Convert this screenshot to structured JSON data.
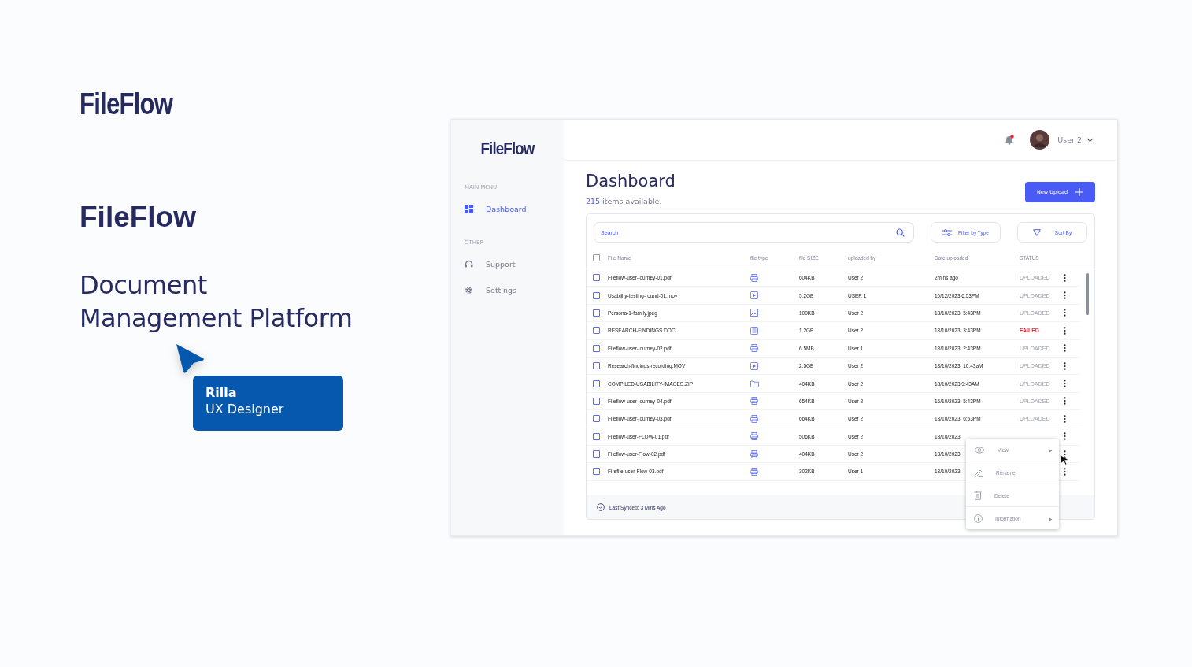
{
  "slide": {
    "logo": "FileFlow",
    "product": "FileFlow",
    "tagline": [
      "Document",
      "Management Platform"
    ],
    "badge": {
      "name": "Rilla",
      "role": "UX Designer"
    }
  },
  "app": {
    "logo": "FileFlow",
    "sidebar": [
      {
        "heading": "MAIN MENU",
        "items": [
          {
            "label": "Dashboard",
            "kind": "grid",
            "selected": true
          }
        ]
      },
      {
        "heading": "OTHER",
        "items": [
          {
            "label": "Support",
            "kind": "headset",
            "selected": false
          },
          {
            "label": "Settings",
            "kind": "gear",
            "selected": false
          }
        ]
      }
    ],
    "user": {
      "name": "User 2",
      "notification": true
    },
    "title": "Dashboard",
    "count": "215",
    "count_suffix": "items available.",
    "new_button": "New Upload",
    "search": {
      "placeholder": "Search"
    },
    "filter_button": "Filter by Type",
    "sort_button": "Sort By",
    "table": {
      "header_checked": false,
      "columns": [
        "File Name",
        "file type",
        "file SIZE",
        "uploaded by",
        "Date uploaded",
        "STATUS"
      ],
      "rows": [
        {
          "checked": false,
          "name": "Fileflow-user-journey-01.pdf",
          "kind": "pdf",
          "size": "604KB",
          "by": "User 2",
          "date": "2mins ago",
          "status": "UPLOADED",
          "failed": false
        },
        {
          "checked": false,
          "name": "Usability-testing-round-01.mov",
          "kind": "video",
          "size": "5.2GB",
          "by": "USER 1",
          "date": "10/12/2023 6:53PM",
          "status": "UPLOADED",
          "failed": false
        },
        {
          "checked": false,
          "name": "Persona-1-family.jpeg",
          "kind": "image",
          "size": "100KB",
          "by": "User 2",
          "date": "18/10/2023  5:43PM",
          "status": "UPLOADED",
          "failed": false
        },
        {
          "checked": false,
          "name": "RESEARCH-FINDINGS.DOC",
          "kind": "doc",
          "size": "1.2GB",
          "by": "User 2",
          "date": "18/10/2023  3:43PM",
          "status": "FAILED",
          "failed": true
        },
        {
          "checked": false,
          "name": "Fileflow-user-journey-02.pdf",
          "kind": "pdf",
          "size": "6.5MB",
          "by": "User 1",
          "date": "18/10/2023  2:43PM",
          "status": "UPLOADED",
          "failed": false
        },
        {
          "checked": false,
          "name": "Research-findings-recording.MOV",
          "kind": "video",
          "size": "2.5GB",
          "by": "User 2",
          "date": "18/10/2023  10:43aM",
          "status": "UPLOADED",
          "failed": false
        },
        {
          "checked": false,
          "name": "COMPILED-USABILITY-IMAGES.ZIP",
          "kind": "folder",
          "size": "404KB",
          "by": "User 2",
          "date": "18/10/2023 9:43AM",
          "status": "UPLOADED",
          "failed": false
        },
        {
          "checked": false,
          "name": "Fileflow-user-journey-04.pdf",
          "kind": "pdf",
          "size": "654KB",
          "by": "User 2",
          "date": "16/10/2023  5:43PM",
          "status": "UPLOADED",
          "failed": false
        },
        {
          "checked": false,
          "name": "Fileflow-user-journey-03.pdf",
          "kind": "pdf",
          "size": "664KB",
          "by": "User 2",
          "date": "13/10/2023  6:53PM",
          "status": "UPLOADED",
          "failed": false
        },
        {
          "checked": false,
          "name": "Fileflow-user-FLOW-01.pdf",
          "kind": "pdf",
          "size": "506KB",
          "by": "User 2",
          "date": "13/10/2023"
        },
        {
          "checked": false,
          "name": "Fileflow-user-Flow-02.pdf",
          "kind": "pdf",
          "size": "404KB",
          "by": "User 2",
          "date": "13/10/2023"
        },
        {
          "checked": false,
          "name": "Firefile-user-Flow-03.pdf",
          "kind": "pdf",
          "size": "302KB",
          "by": "User 1",
          "date": "13/10/2023"
        }
      ]
    },
    "context_menu": [
      {
        "label": "View",
        "kind": "eye",
        "submenu": true
      },
      {
        "label": "Rename",
        "kind": "pen",
        "submenu": false
      },
      {
        "label": "Delete",
        "kind": "trash",
        "submenu": false
      },
      {
        "label": "Information",
        "kind": "info",
        "submenu": true
      }
    ],
    "submenu_arrow": "▶",
    "status_bar": "Last Synced: 3 Mins Ago"
  }
}
